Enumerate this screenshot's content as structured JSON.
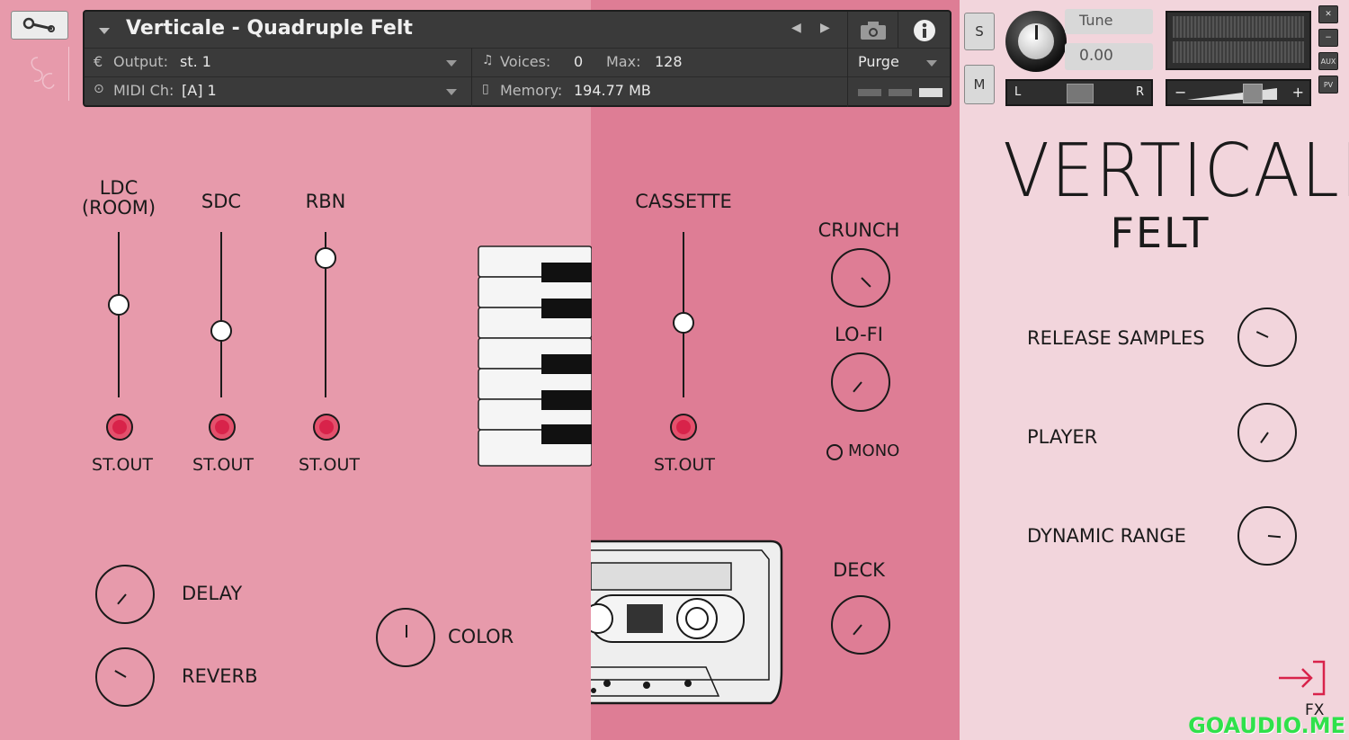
{
  "instrument": {
    "title": "Verticale - Quadruple Felt",
    "output_label": "Output:",
    "output_value": "st. 1",
    "midi_label": "MIDI Ch:",
    "midi_value": "[A]  1",
    "voices_label": "Voices:",
    "voices_value": "0",
    "max_label": "Max:",
    "max_value": "128",
    "memory_label": "Memory:",
    "memory_value": "194.77 MB",
    "purge_label": "Purge"
  },
  "tune": {
    "label": "Tune",
    "value": "0.00"
  },
  "side_buttons": {
    "solo": "S",
    "mute": "M",
    "aux": "AUX",
    "pv": "PV",
    "close": "✕",
    "minimize": "−"
  },
  "pan": {
    "left": "L",
    "right": "R"
  },
  "volume": {
    "minus": "−",
    "plus": "+"
  },
  "mixer": {
    "faders": [
      {
        "label_line1": "LDC",
        "label_line2": "(ROOM)",
        "out_label": "ST.OUT",
        "level": 0.56
      },
      {
        "label_line1": "",
        "label_line2": "SDC",
        "out_label": "ST.OUT",
        "level": 0.4
      },
      {
        "label_line1": "",
        "label_line2": "RBN",
        "out_label": "ST.OUT",
        "level": 0.84
      },
      {
        "label_line1": "",
        "label_line2": "CASSETTE",
        "out_label": "ST.OUT",
        "level": 0.45
      }
    ]
  },
  "knobs_left": {
    "delay": "DELAY",
    "reverb": "REVERB",
    "color": "COLOR"
  },
  "knobs_mid": {
    "crunch": "CRUNCH",
    "lofi": "LO-FI",
    "mono": "MONO",
    "deck": "DECK"
  },
  "brand": {
    "title": "VERTICALE",
    "subtitle": "FELT",
    "logo": "SC"
  },
  "knobs_right": {
    "release": "RELEASE SAMPLES",
    "player": "PLAYER",
    "dynamic": "DYNAMIC RANGE"
  },
  "fx": {
    "label": "FX"
  },
  "watermark": "GOAUDIO.ME",
  "colors": {
    "left_bg": "#e79aab",
    "mid_bg": "#de7d95",
    "right_bg": "#f2d5dc",
    "accent_red": "#d8234a"
  }
}
